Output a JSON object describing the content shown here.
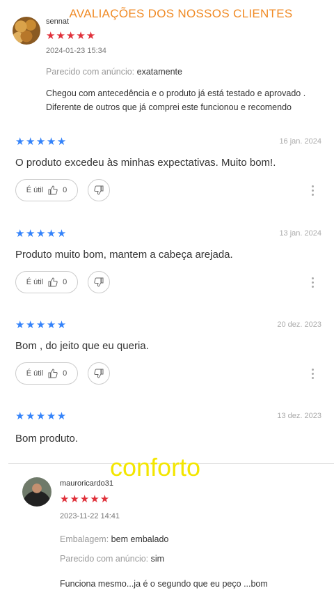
{
  "banner": {
    "title": "AVALIAÇÕES DOS NOSSOS CLIENTES"
  },
  "review1": {
    "username": "sennat",
    "stars": "★★★★★",
    "datetime": "2024-01-23 15:34",
    "similar_key": "Parecido com anúncio:",
    "similar_val": "exatamente",
    "text_line1": "Chegou com antecedência e o produto já está testado e aprovado .",
    "text_line2": "Diferente de outros que já comprei este funcionou e recomendo"
  },
  "reviews": [
    {
      "stars": "★★★★★",
      "date": "16 jan. 2024",
      "text": "O produto excedeu às minhas expectativas. Muito bom!.",
      "useful_label": "É útil",
      "count": "0"
    },
    {
      "stars": "★★★★★",
      "date": "13 jan. 2024",
      "text": "Produto muito bom, mantem a cabeça arejada.",
      "useful_label": "É útil",
      "count": "0"
    },
    {
      "stars": "★★★★★",
      "date": "20 dez. 2023",
      "text": "Bom , do jeito que eu queria.",
      "useful_label": "É útil",
      "count": "0"
    },
    {
      "stars": "★★★★★",
      "date": "13 dez. 2023",
      "text": "Bom produto."
    }
  ],
  "watermark": "conforto",
  "review2": {
    "username": "mauroricardo31",
    "stars": "★★★★★",
    "datetime": "2023-11-22 14:41",
    "packaging_key": "Embalagem:",
    "packaging_val": "bem embalado",
    "similar_key": "Parecido com anúncio:",
    "similar_val": "sim",
    "text": "Funciona mesmo...ja é o segundo que eu peço ...bom"
  },
  "icons": [
    "thumbs-up-icon",
    "thumbs-down-icon",
    "more-vert-icon"
  ],
  "colors": {
    "banner": "#f08a24",
    "star_red": "#e0303a",
    "star_blue": "#3483fa",
    "watermark": "#f3e600"
  }
}
